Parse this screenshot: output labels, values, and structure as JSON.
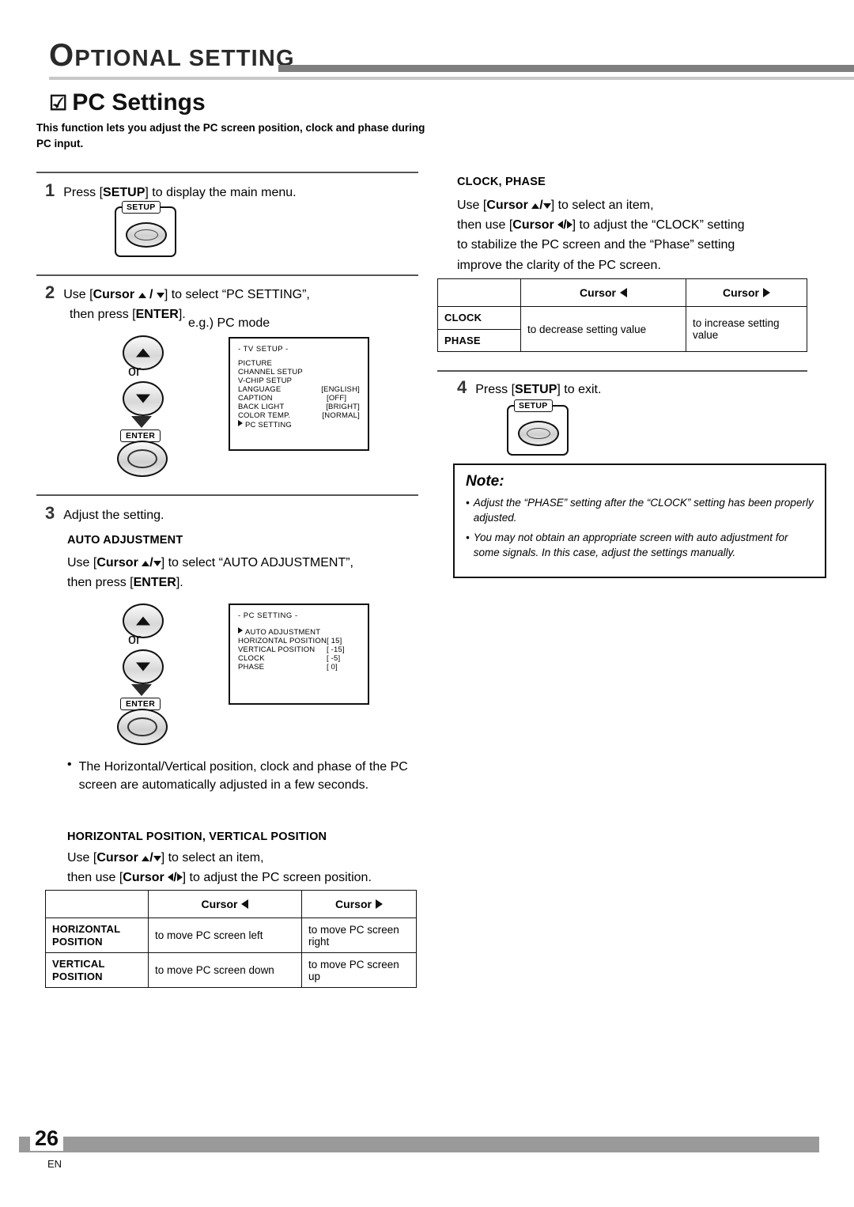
{
  "header": {
    "title_first": "O",
    "title_rest": "PTIONAL SETTING"
  },
  "section": {
    "checkbox": "☑",
    "title": "PC Settings",
    "description": "This function lets you adjust the PC screen position, clock and phase during PC input."
  },
  "left": {
    "step1": {
      "num": "1",
      "text_a": "Press [",
      "text_b": "SETUP",
      "text_c": "] to display the main menu.",
      "key_label": "SETUP"
    },
    "step2": {
      "num": "2",
      "line1_a": "Use [",
      "line1_b": "Cursor",
      "line1_c": "] to select “PC SETTING”,",
      "line2_a": "then press [",
      "line2_b": "ENTER",
      "line2_c": "].",
      "or": "or",
      "enter_label": "ENTER",
      "eg": "e.g.) PC mode"
    },
    "osd_tv_setup": {
      "title": "- TV SETUP -",
      "rows": [
        {
          "name": "PICTURE",
          "value": ""
        },
        {
          "name": "CHANNEL SETUP",
          "value": ""
        },
        {
          "name": "V-CHIP SETUP",
          "value": ""
        },
        {
          "name": "LANGUAGE",
          "value": "[ENGLISH]"
        },
        {
          "name": "CAPTION",
          "value": "[OFF]"
        },
        {
          "name": "BACK LIGHT",
          "value": "[BRIGHT]"
        },
        {
          "name": "COLOR TEMP.",
          "value": "[NORMAL]"
        },
        {
          "name": "PC SETTING",
          "value": "",
          "marker": true
        }
      ]
    },
    "step3": {
      "num": "3",
      "text": "Adjust the setting."
    },
    "auto_adjustment": {
      "heading": "AUTO ADJUSTMENT",
      "line1_a": "Use [",
      "line1_b": "Cursor",
      "line1_c": "] to select “AUTO ADJUSTMENT”,",
      "line2_a": "then press [",
      "line2_b": "ENTER",
      "line2_c": "].",
      "or": "or",
      "enter_label": "ENTER"
    },
    "osd_pc_setting": {
      "title": "- PC SETTING -",
      "rows": [
        {
          "name": "AUTO ADJUSTMENT",
          "value": "",
          "marker": true
        },
        {
          "name": "HORIZONTAL POSITION",
          "value": "[   15]"
        },
        {
          "name": "VERTICAL POSITION",
          "value": "[ -15]"
        },
        {
          "name": "CLOCK",
          "value": "[   -5]"
        },
        {
          "name": "PHASE",
          "value": "[    0]"
        }
      ]
    },
    "bullet": "The Horizontal/Vertical position, clock and phase of the PC screen are automatically adjusted in a few seconds.",
    "hv_position": {
      "heading": "HORIZONTAL POSITION, VERTICAL POSITION",
      "line1_a": "Use [",
      "line1_b": "Cursor",
      "line1_c": "] to select an item,",
      "line2_a": "then use [",
      "line2_b": "Cursor",
      "line2_c": "] to adjust the PC screen position."
    },
    "hv_table": {
      "col0": "",
      "col1": "Cursor",
      "col2": "Cursor",
      "rows": [
        {
          "label_l1": "HORIZONTAL",
          "label_l2": "POSITION",
          "left": "to move PC screen left",
          "right": "to move PC screen right"
        },
        {
          "label_l1": "VERTICAL",
          "label_l2": "POSITION",
          "left": "to move PC screen down",
          "right": "to move PC screen up"
        }
      ]
    }
  },
  "right": {
    "clock_phase": {
      "heading": "CLOCK, PHASE",
      "line1_a": "Use [",
      "line1_b": "Cursor",
      "line1_c": "] to select an item,",
      "line2_a": "then use [",
      "line2_b": "Cursor",
      "line2_c": "] to adjust the “CLOCK” setting",
      "line3": "to stabilize the PC screen and the “Phase” setting",
      "line4": "improve the clarity of the PC screen."
    },
    "cp_table": {
      "col1": "Cursor",
      "col2": "Cursor",
      "row_clock": "CLOCK",
      "row_phase": "PHASE",
      "left": "to decrease setting value",
      "right": "to increase setting value"
    },
    "step4": {
      "num": "4",
      "text_a": "Press [",
      "text_b": "SETUP",
      "text_c": "] to exit.",
      "key_label": "SETUP"
    },
    "note": {
      "title": "Note:",
      "items": [
        "Adjust the “PHASE” setting after the “CLOCK” setting has been properly adjusted.",
        "You may not obtain an appropriate screen with auto adjustment for some signals. In this case, adjust the settings manually."
      ]
    }
  },
  "footer": {
    "page": "26",
    "lang": "EN"
  }
}
